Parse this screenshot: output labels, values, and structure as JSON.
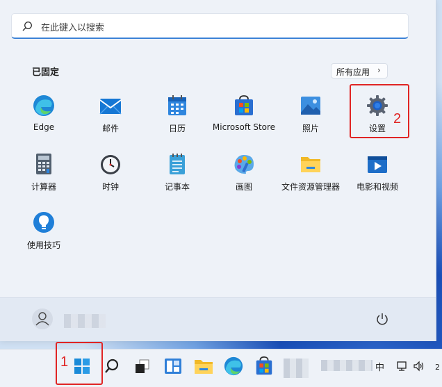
{
  "search": {
    "placeholder": "在此键入以搜索"
  },
  "pinned": {
    "title": "已固定",
    "all_apps_label": "所有应用",
    "apps": [
      {
        "label": "Edge",
        "icon": "edge-icon"
      },
      {
        "label": "邮件",
        "icon": "mail-icon"
      },
      {
        "label": "日历",
        "icon": "calendar-icon"
      },
      {
        "label": "Microsoft Store",
        "icon": "store-icon"
      },
      {
        "label": "照片",
        "icon": "photos-icon"
      },
      {
        "label": "设置",
        "icon": "settings-gear-icon"
      },
      {
        "label": "计算器",
        "icon": "calculator-icon"
      },
      {
        "label": "时钟",
        "icon": "clock-icon"
      },
      {
        "label": "记事本",
        "icon": "notepad-icon"
      },
      {
        "label": "画图",
        "icon": "paint-icon"
      },
      {
        "label": "文件资源管理器",
        "icon": "file-explorer-icon"
      },
      {
        "label": "电影和视频",
        "icon": "movies-tv-icon"
      },
      {
        "label": "使用技巧",
        "icon": "tips-icon"
      }
    ]
  },
  "annotations": {
    "step1": "1",
    "step2": "2",
    "color": "#e02424"
  },
  "taskbar": {
    "icons": [
      "windows-start-icon",
      "search-icon",
      "task-view-icon",
      "widgets-icon",
      "file-explorer-icon",
      "edge-icon",
      "store-icon"
    ],
    "ime": "中",
    "clock_partial": "2"
  },
  "colors": {
    "accent": "#3b82d6",
    "panel": "#eef2f8"
  }
}
